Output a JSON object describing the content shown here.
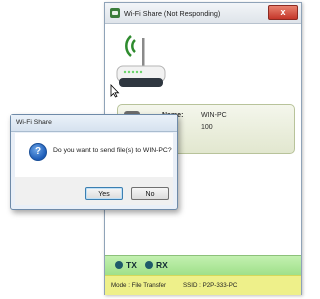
{
  "main_window": {
    "title": "Wi-Fi Share (Not Responding)",
    "close_glyph": "x",
    "device": {
      "name_label": "Name:",
      "name_value": "WIN-PC",
      "id_value": "100"
    },
    "tx_label": "TX",
    "rx_label": "RX",
    "mode_text": "Mode : File Transfer",
    "ssid_text": "SSID : P2P-333-PC",
    "colors": {
      "router_wave": "#2e8b2e",
      "txrx_bar": "#a8e594",
      "mode_bar": "#eef08a",
      "device_card": "#e6ebd6"
    }
  },
  "dialog": {
    "title": "Wi-Fi Share",
    "message": "Do you want to send file(s) to WIN-PC?",
    "yes_label": "Yes",
    "no_label": "No",
    "icon": "question-icon"
  }
}
